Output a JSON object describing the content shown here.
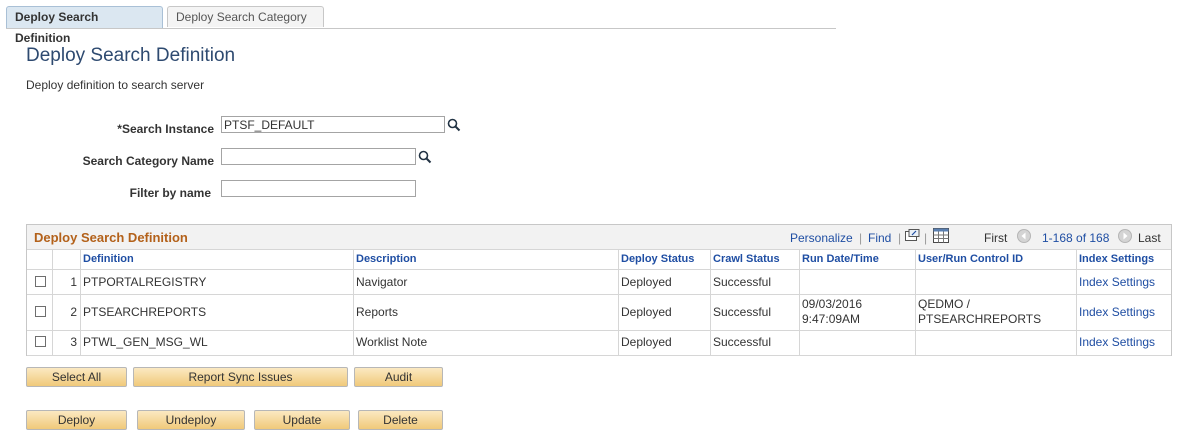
{
  "tabs": {
    "active": "Deploy Search Definition",
    "inactive": "Deploy Search Category"
  },
  "page": {
    "title": "Deploy Search Definition",
    "description": "Deploy definition to search server"
  },
  "form": {
    "search_instance_label": "*Search Instance",
    "search_instance_value": "PTSF_DEFAULT",
    "search_category_label": "Search Category Name",
    "search_category_value": "",
    "filter_label": "Filter by name",
    "filter_value": ""
  },
  "grid": {
    "title": "Deploy Search Definition",
    "personalize": "Personalize",
    "find": "Find",
    "separator": "|",
    "first": "First",
    "range": "1-168 of 168",
    "last": "Last",
    "columns": [
      "Definition",
      "Description",
      "Deploy Status",
      "Crawl Status",
      "Run Date/Time",
      "User/Run Control ID",
      "Index Settings"
    ],
    "rows": [
      {
        "num": "1",
        "definition": "PTPORTALREGISTRY",
        "description": "Navigator",
        "deploy_status": "Deployed",
        "crawl_status": "Successful",
        "run_date": "",
        "run_time": "",
        "user": "",
        "run_control": "",
        "index": "Index Settings"
      },
      {
        "num": "2",
        "definition": "PTSEARCHREPORTS",
        "description": "Reports",
        "deploy_status": "Deployed",
        "crawl_status": "Successful",
        "run_date": "09/03/2016",
        "run_time": "9:47:09AM",
        "user": "QEDMO /",
        "run_control": "PTSEARCHREPORTS",
        "index": "Index Settings"
      },
      {
        "num": "3",
        "definition": "PTWL_GEN_MSG_WL",
        "description": "Worklist Note",
        "deploy_status": "Deployed",
        "crawl_status": "Successful",
        "run_date": "",
        "run_time": "",
        "user": "",
        "run_control": "",
        "index": "Index Settings"
      }
    ]
  },
  "buttons": {
    "select_all": "Select All",
    "report_sync": "Report Sync Issues",
    "audit": "Audit",
    "deploy": "Deploy",
    "undeploy": "Undeploy",
    "update": "Update",
    "delete": "Delete"
  },
  "icons": {
    "lookup": "magnifier-icon",
    "zoom": "new-window-icon",
    "download": "spreadsheet-icon",
    "prev": "arrow-left-icon",
    "next": "arrow-right-icon"
  },
  "colors": {
    "title_blue": "#2e4a70",
    "link_blue": "#1f4ea3",
    "grid_title_orange": "#b3611a",
    "button_gradient_top": "#fbe9c2",
    "button_gradient_bottom": "#f0c97a"
  }
}
